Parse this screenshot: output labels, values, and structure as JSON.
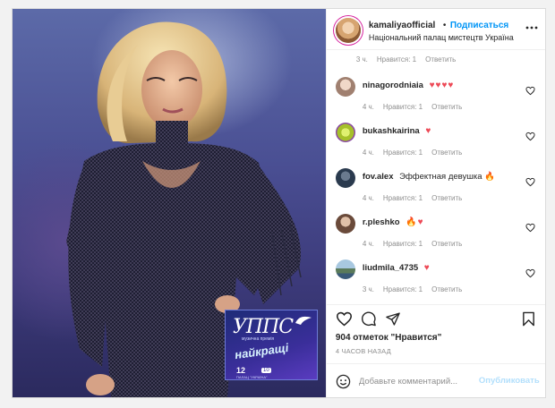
{
  "header": {
    "username": "kamaliyaofficial",
    "separator": "•",
    "follow_label": "Подписаться",
    "location": "Національний палац мистецтв Україна"
  },
  "promo": {
    "title": "УППС",
    "subtitle": "музична премія",
    "headline": "найкращі",
    "date_day": "12",
    "date_badge": "10",
    "venue": "ПАЛАЦ \"УКРАЇНА\""
  },
  "comments": {
    "top_meta": {
      "time": "3 ч.",
      "likes": "Нравится: 1",
      "reply": "Ответить"
    },
    "items": [
      {
        "username": "ninagorodniaia",
        "text": "♥♥♥♥",
        "time": "4 ч.",
        "likes": "Нравится: 1",
        "reply": "Ответить",
        "avatar_color": "#c8b4a8"
      },
      {
        "username": "bukashkairina",
        "text": "♥",
        "time": "4 ч.",
        "likes": "Нравится: 1",
        "reply": "Ответить",
        "avatar_color": "#b6d04a"
      },
      {
        "username": "fov.alex",
        "text": "Эффектная девушка 🔥",
        "time": "4 ч.",
        "likes": "Нравится: 1",
        "reply": "Ответить",
        "avatar_color": "#2a3a4e"
      },
      {
        "username": "r.pleshko",
        "text": "🔥♥",
        "time": "4 ч.",
        "likes": "Нравится: 1",
        "reply": "Ответить",
        "avatar_color": "#8c6e5a"
      },
      {
        "username": "liudmila_4735",
        "text": "♥",
        "time": "3 ч.",
        "likes": "Нравится: 1",
        "reply": "Ответить",
        "avatar_color": "#6a8aa0"
      }
    ]
  },
  "stats": {
    "likes": "904 отметок \"Нравится\"",
    "ago": "4 ЧАСОВ НАЗАД"
  },
  "composer": {
    "placeholder": "Добавьте комментарий...",
    "publish_label": "Опубликовать"
  },
  "colors": {
    "accent": "#0095f6",
    "heart": "#ed4956",
    "muted": "#8e8e8e"
  }
}
